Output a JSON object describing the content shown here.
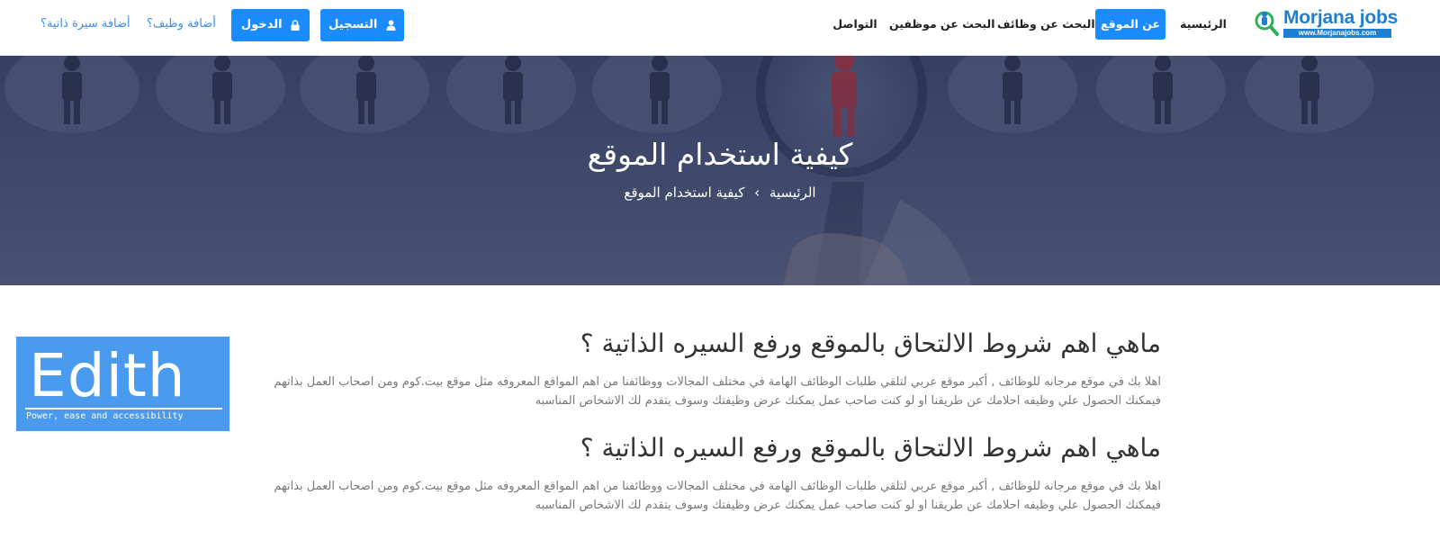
{
  "logo": {
    "text": "Morjana jobs",
    "url_text": "www.Morjanajobs.com"
  },
  "nav": {
    "home": "الرئيسية",
    "about": "عن الموقع",
    "search_jobs": "البحث عن وظائف",
    "search_employees": "البحث عن موظفين",
    "contact": "التواصل"
  },
  "actions": {
    "register": "التسجيل",
    "login": "الدخول",
    "add_job": "أضافة وظيف؟",
    "add_cv": "أضافة سيرة ذاتية؟"
  },
  "hero": {
    "title": "كيفية استخدام الموقع",
    "breadcrumb_home": "الرئيسية",
    "breadcrumb_sep": "›",
    "breadcrumb_current": "كيفية استخدام الموقع"
  },
  "edith": {
    "word": "Edith",
    "tagline": "Power, ease and accessibility"
  },
  "sections": [
    {
      "heading": "ماهي اهم شروط الالتحاق بالموقع ورفع السيره الذاتية ؟",
      "body": "اهلا بك في موقع مرجانه للوظائف , أكبر موقع عربي لتلقي طلبات الوظائف الهامة في مختلف المجالات ووظائفنا من اهم المواقع المعروفه مثل موقع بيت.كوم ومن اصحاب العمل بذاتهم فيمكنك الحصول علي وظيفه احلامك عن طريقنا او لو كنت صاحب عمل يمكنك عرض وظيفتك وسوف يتقدم لك الاشخاص المناسبه"
    },
    {
      "heading": "ماهي اهم شروط الالتحاق بالموقع ورفع السيره الذاتية ؟",
      "body": "اهلا بك في موقع مرجانه للوظائف , أكبر موقع عربي لتلقي طلبات الوظائف الهامة في مختلف المجالات ووظائفنا من اهم المواقع المعروفه مثل موقع بيت.كوم ومن اصحاب العمل بذاتهم فيمكنك الحصول علي وظيفه احلامك عن طريقنا او لو كنت صاحب عمل يمكنك عرض وظيفتك وسوف يتقدم لك الاشخاص المناسبه"
    }
  ],
  "colors": {
    "accent": "#1a8cff",
    "logo_blue": "#1e7fd0",
    "link": "#3a8ee6",
    "edith_bg": "#4a9bf0",
    "person_highlight": "#b0303a"
  },
  "icons": {
    "register": "user-icon",
    "login": "lock-icon",
    "logo": "magnifier-person-icon"
  }
}
